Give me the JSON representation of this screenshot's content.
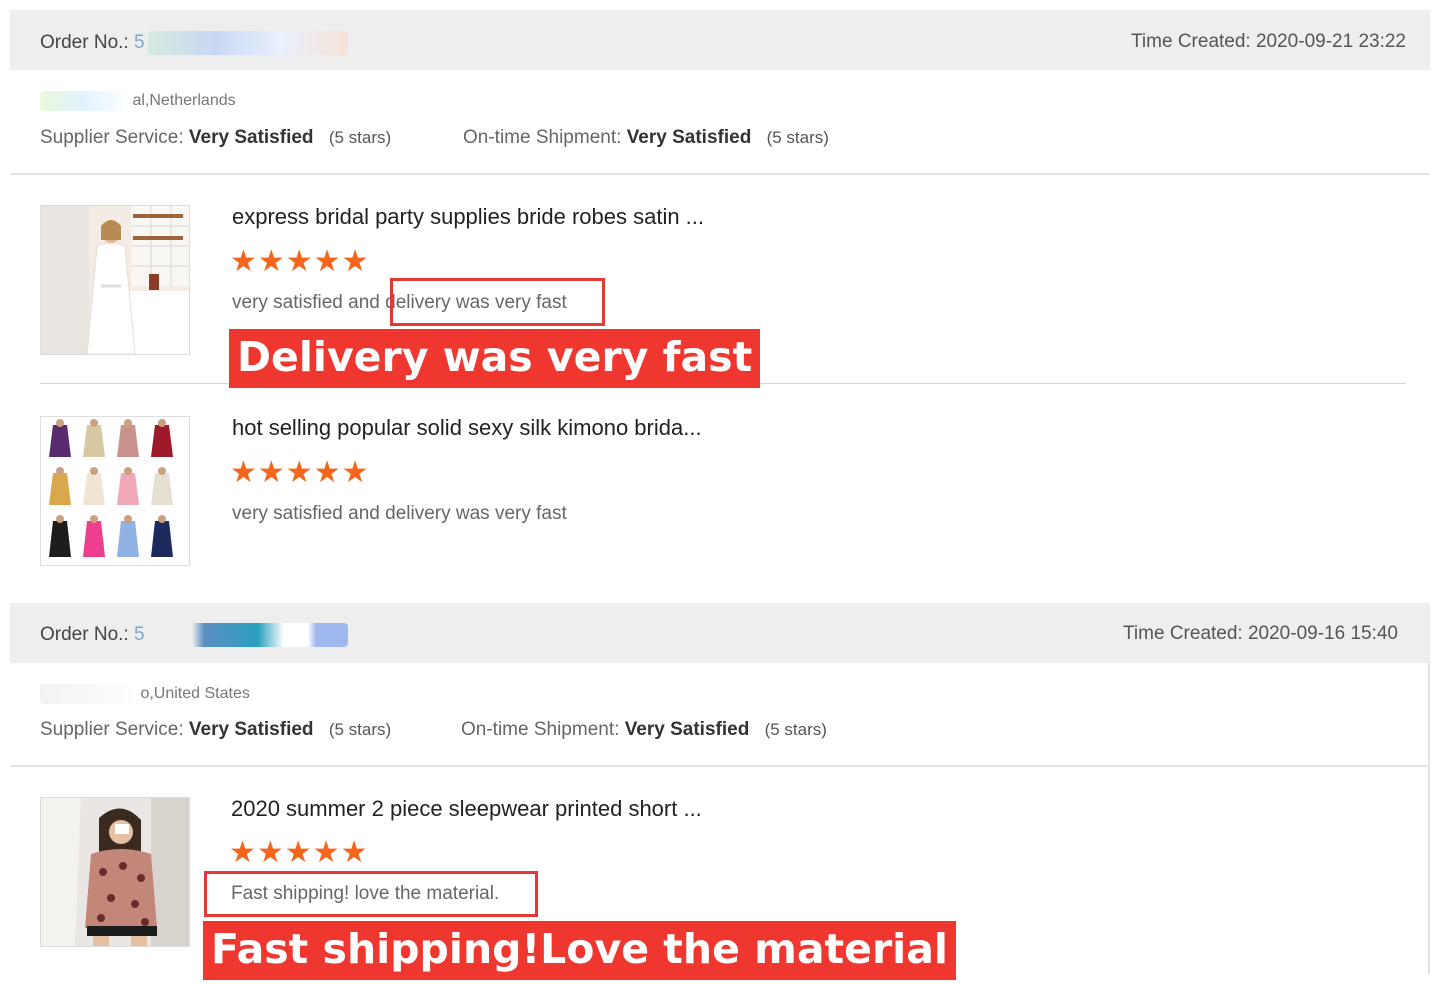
{
  "orders": [
    {
      "order_label": "Order No.:",
      "order_visible": "5",
      "time_label": "Time Created:",
      "time_value": "2020-09-21 23:22",
      "buyer_location": "al,Netherlands",
      "supplier_label": "Supplier Service:",
      "supplier_value": "Very Satisfied",
      "supplier_stars": "(5 stars)",
      "shipment_label": "On-time Shipment:",
      "shipment_value": "Very Satisfied",
      "shipment_stars": "(5 stars)",
      "items": [
        {
          "title": "express bridal party supplies bride robes satin ...",
          "stars": "★★★★★",
          "rating": 5,
          "review": "very satisfied and delivery was very fast",
          "highlight_text": "delivery was very fast",
          "banner": "Delivery was very fast"
        },
        {
          "title": "hot selling popular solid sexy silk kimono brida...",
          "stars": "★★★★★",
          "rating": 5,
          "review": "very satisfied and delivery was very fast"
        }
      ]
    },
    {
      "order_label": "Order No.:",
      "order_visible": "5",
      "time_label": "Time Created:",
      "time_value": "2020-09-16 15:40",
      "buyer_location": "o,United States",
      "supplier_label": "Supplier Service:",
      "supplier_value": "Very Satisfied",
      "supplier_stars": "(5 stars)",
      "shipment_label": "On-time Shipment:",
      "shipment_value": "Very Satisfied",
      "shipment_stars": "(5 stars)",
      "items": [
        {
          "title": "2020 summer 2 piece sleepwear printed short ...",
          "stars": "★★★★★",
          "rating": 5,
          "review": "Fast shipping! love the material.",
          "banner": "Fast shipping!Love the material"
        }
      ]
    }
  ],
  "colors": {
    "star": "#f5651c",
    "highlight": "#e53935",
    "banner_bg": "#f0372f",
    "header_bg": "#eeeeee"
  }
}
